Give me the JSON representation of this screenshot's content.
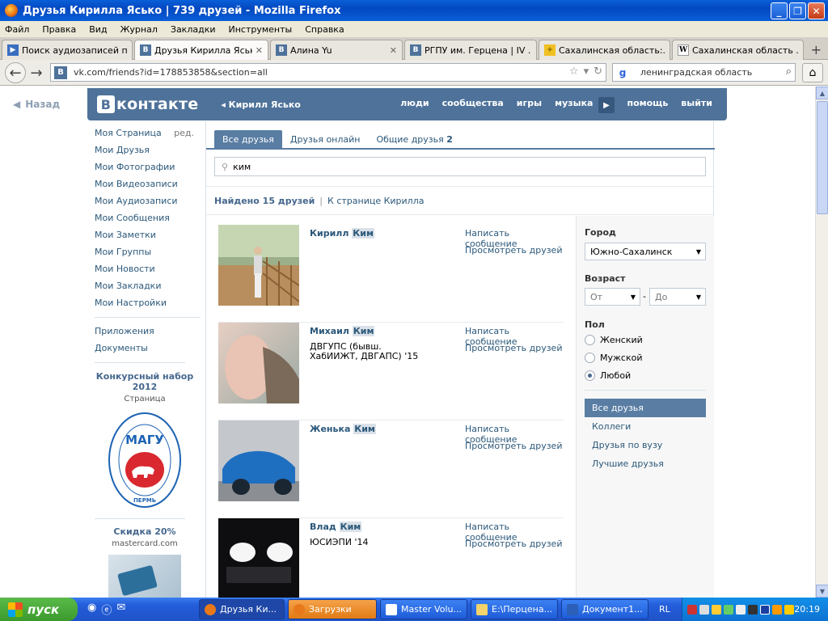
{
  "window": {
    "title": "Друзья Кирилла Ясько | 739 друзей - Mozilla Firefox"
  },
  "menu": [
    "Файл",
    "Правка",
    "Вид",
    "Журнал",
    "Закладки",
    "Инструменты",
    "Справка"
  ],
  "tabs": [
    {
      "label": "Поиск аудиозаписей п...",
      "icon": "play-icon"
    },
    {
      "label": "Друзья Кирилла Ясько...",
      "icon": "vk-icon",
      "active": true
    },
    {
      "label": "Алина Yu",
      "icon": "vk-icon"
    },
    {
      "label": "РГПУ им. Герцена | IV ...",
      "icon": "vk-icon"
    },
    {
      "label": "Сахалинская область:...",
      "icon": "plus-icon"
    },
    {
      "label": "Сахалинская область ...",
      "icon": "wikipedia-icon"
    }
  ],
  "urlbar": {
    "url": "vk.com/friends?id=178853858&section=all"
  },
  "search": {
    "query": "ленинградская область"
  },
  "vk": {
    "back": "Назад",
    "logo": "контакте",
    "user": "Кирилл Ясько",
    "nav": [
      "люди",
      "сообщества",
      "игры",
      "музыка",
      "помощь",
      "выйти"
    ],
    "sidebar": [
      "Моя Страница",
      "Мои Друзья",
      "Мои Фотографии",
      "Мои Видеозаписи",
      "Мои Аудиозаписи",
      "Мои Сообщения",
      "Мои Заметки",
      "Мои Группы",
      "Мои Новости",
      "Мои Закладки",
      "Мои Настройки"
    ],
    "sidebar_edit": "ред.",
    "sidebar_extra": [
      "Приложения",
      "Документы"
    ],
    "promo1": {
      "title": "Конкурсный набор 2012",
      "sub": "Страница",
      "logo_text": "МАГУ",
      "ring_top": "Малая академия государственного управления",
      "ring_bottom": "ПЕРМЬ"
    },
    "promo2": {
      "title": "Скидка 20%",
      "sub": "mastercard.com"
    },
    "friend_tabs": [
      "Все друзья",
      "Друзья онлайн",
      "Общие друзья"
    ],
    "common_count": "2",
    "filter": "ким",
    "found": "Найдено 15 друзей",
    "to_page": "К странице Кирилла",
    "friends": [
      {
        "first": "Кирилл",
        "last": "Ким",
        "info": "",
        "photo": "photo-1"
      },
      {
        "first": "Михаил",
        "last": "Ким",
        "info": "ДВГУПС (бывш. ХабИИЖТ, ДВГАПС) '15",
        "photo": "photo-2"
      },
      {
        "first": "Женька",
        "last": "Ким",
        "info": "",
        "photo": "photo-3"
      },
      {
        "first": "Влад",
        "last": "Ким",
        "info": "ЮСИЭПИ '14",
        "photo": "photo-4"
      }
    ],
    "actions": [
      "Написать сообщение",
      "Просмотреть друзей"
    ],
    "right": {
      "city_label": "Город",
      "city": "Южно-Сахалинск",
      "age_label": "Возраст",
      "age_from": "От",
      "age_dash": "-",
      "age_to": "До",
      "sex_label": "Пол",
      "sex": [
        "Женский",
        "Мужской",
        "Любой"
      ],
      "sex_selected": 2,
      "nav": [
        "Все друзья",
        "Коллеги",
        "Друзья по вузу",
        "Лучшие друзья"
      ]
    }
  },
  "taskbar": {
    "start": "пуск",
    "buttons": [
      "Друзья Ки...",
      "Загрузки",
      "Master Volu...",
      "E:\\Перцена...",
      "Документ1..."
    ],
    "lang": "RL",
    "clock": "20:19"
  }
}
